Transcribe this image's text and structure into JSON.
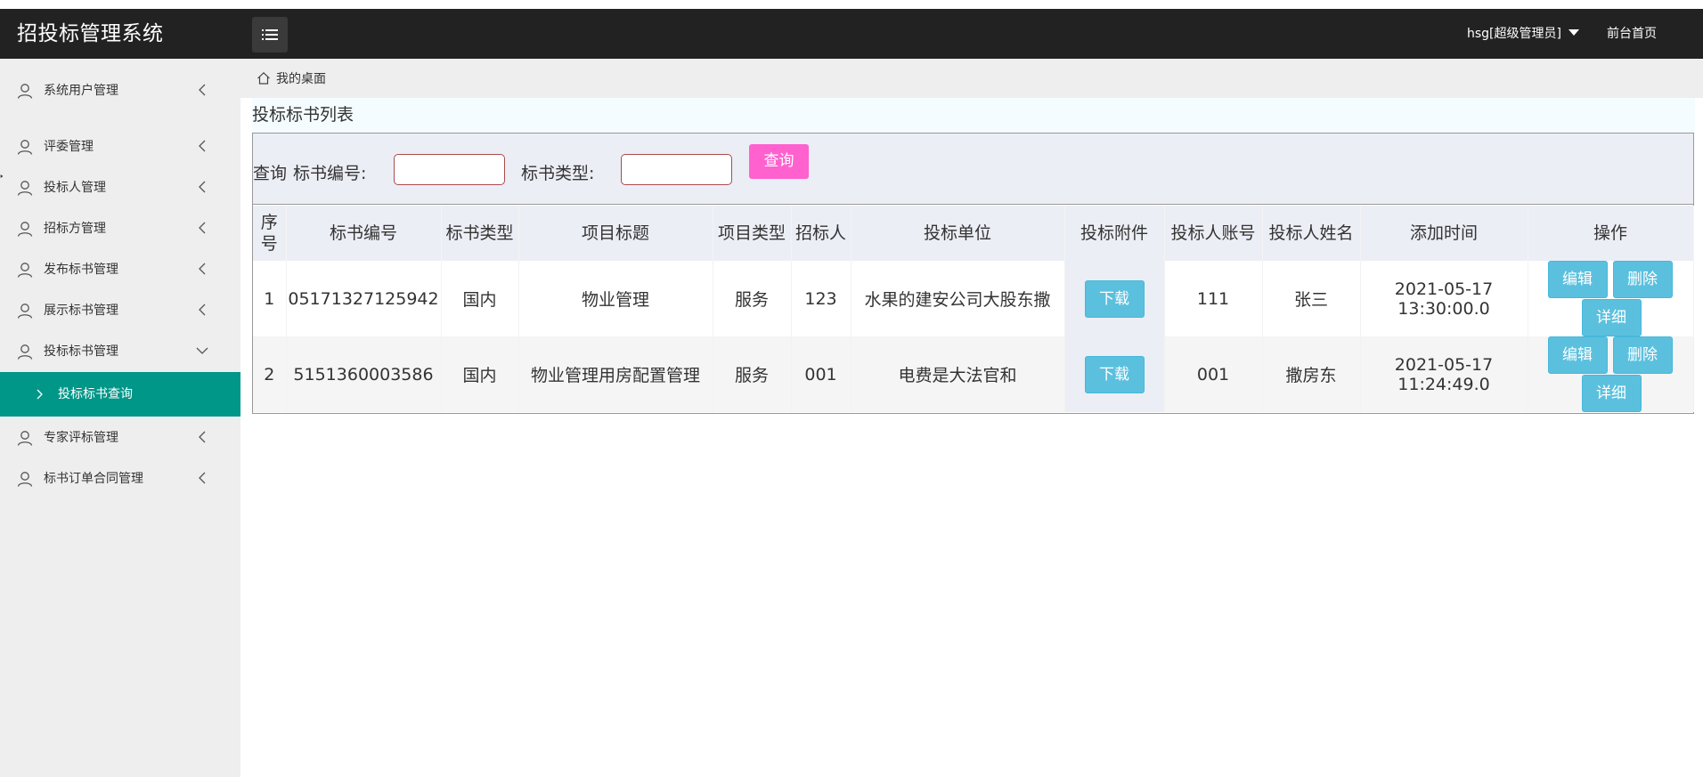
{
  "app": {
    "title": "招投标管理系统"
  },
  "header": {
    "user_label": "hsg[超级管理员]",
    "front_link": "前台首页"
  },
  "sidebar": {
    "items": [
      {
        "label": "系统用户管理"
      },
      {
        "label": "评委管理"
      },
      {
        "label": "投标人管理"
      },
      {
        "label": "招标方管理"
      },
      {
        "label": "发布标书管理"
      },
      {
        "label": "展示标书管理"
      },
      {
        "label": "投标标书管理"
      },
      {
        "label": "专家评标管理"
      },
      {
        "label": "标书订单合同管理"
      }
    ],
    "active_sub": "投标标书查询"
  },
  "breadcrumb": {
    "label": "我的桌面"
  },
  "main": {
    "title": "投标标书列表",
    "search": {
      "prefix": "查询",
      "field1_label": "标书编号:",
      "field1_value": "",
      "field2_label": "标书类型:",
      "field2_value": "",
      "button": "查询"
    },
    "table": {
      "headers": [
        "序号",
        "标书编号",
        "标书类型",
        "项目标题",
        "项目类型",
        "招标人",
        "投标单位",
        "投标附件",
        "投标人账号",
        "投标人姓名",
        "添加时间",
        "操作"
      ],
      "rows": [
        {
          "no": "1",
          "code": "05171327125942",
          "type": "国内",
          "title": "物业管理",
          "ptype": "服务",
          "tenderer": "123",
          "unit": "水果的建安公司大股东撒",
          "attach": "下载",
          "account": "111",
          "name": "张三",
          "date": "2021-05-17",
          "time": "13:30:00.0"
        },
        {
          "no": "2",
          "code": "5151360003586",
          "type": "国内",
          "title": "物业管理用房配置管理",
          "ptype": "服务",
          "tenderer": "001",
          "unit": "电费是大法官和",
          "attach": "下载",
          "account": "001",
          "name": "撒房东",
          "date": "2021-05-17",
          "time": "11:24:49.0"
        }
      ],
      "actions": {
        "edit": "编辑",
        "delete": "删除",
        "detail": "详细"
      }
    }
  },
  "colors": {
    "header": "#222222",
    "active": "#009688",
    "query_button": "#ff61cf",
    "action_button": "#5bc0de"
  }
}
